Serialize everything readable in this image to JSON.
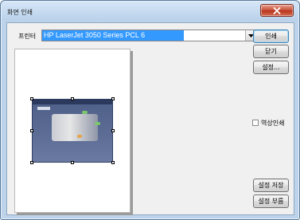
{
  "window": {
    "title": "화면 인쇄",
    "close_icon": "close-icon"
  },
  "printer": {
    "label": "프린터",
    "selected": "HP LaserJet 3050 Series PCL 6"
  },
  "buttons": {
    "print": "인쇄",
    "close": "닫기",
    "settings": "설정...",
    "save_settings": "설정 저장",
    "load_settings": "설정 부름"
  },
  "options": {
    "color_print_label": "역상인쇄",
    "color_print_checked": false
  },
  "colors": {
    "accent": "#3399ff",
    "title_bar": "#bcd3ea",
    "close_button": "#c9513a"
  }
}
